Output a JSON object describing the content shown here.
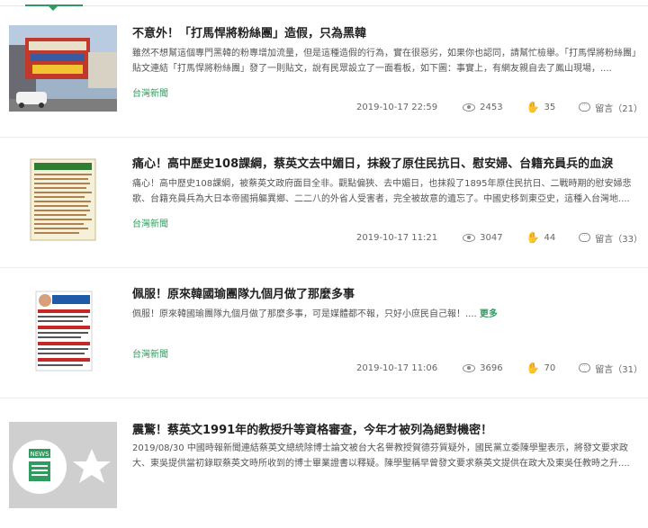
{
  "articles": [
    {
      "title": "不意外！「打馬悍將粉絲團」造假，只為黑韓",
      "summary": "雖然不想幫這個專門黑韓的粉專增加流量，但是這種造假的行為，實在很惡劣，如果你也認同，請幫忙檢舉。「打馬悍將粉絲團」貼文連結「打馬悍將粉絲團」發了一則貼文，說有民眾設立了一面看板，如下圖：事實上，有網友親自去了鳳山現場，....",
      "more": "",
      "source": "台灣新聞",
      "date": "2019-10-17 22:59",
      "views": "2453",
      "likes": "35",
      "comments": "留言（21）"
    },
    {
      "title": "痛心！高中歷史108課綱，蔡英文去中媚日，抹殺了原住民抗日、慰安婦、台籍充員兵的血淚",
      "summary": "痛心！高中歷史108課綱，被蔡英文政府面目全非。觀點偏狹、去中媚日，也抹殺了1895年原住民抗日、二戰時期的慰安婦悲歌、台籍充員兵為大日本帝國捐軀異鄉、二二八的外省人受害者，完全被故意的遺忘了。中國史移到東亞史，這種入台灣地....",
      "more": "",
      "source": "台灣新聞",
      "date": "2019-10-17 11:21",
      "views": "3047",
      "likes": "44",
      "comments": "留言（33）"
    },
    {
      "title": "佩服！原來韓國瑜團隊九個月做了那麼多事",
      "summary": "佩服！原來韓國瑜團隊九個月做了那麼多事，可是媒體都不報，只好小庶民自己報！....",
      "more": "更多",
      "source": "台灣新聞",
      "date": "2019-10-17 11:06",
      "views": "3696",
      "likes": "70",
      "comments": "留言（31）"
    },
    {
      "title": "震驚！蔡英文1991年的教授升等資格審查，今年才被列為絕對機密！",
      "summary": "2019/08/30 中國時報新聞連結蔡英文總統除博士論文被台大名譽教授賀德芬質疑外，國民黨立委陳學聖表示，將發文要求政大、東吳提供當初錄取蔡英文時所收到的博士畢業證書以釋疑。陳學聖稱早曾發文要求蔡英文提供在政大及東吳任教時之升....",
      "more": "",
      "source": "",
      "date": "",
      "views": "",
      "likes": "",
      "comments": ""
    }
  ],
  "thumb_badge": "NEWS",
  "thumb2_heading": "原住民抗日／慰安婦 課綱刪除",
  "thumb3_heading": "韓國瑜用心努力",
  "colors": {
    "accent": "#2e9c5e",
    "text": "#222222",
    "muted": "#666666"
  },
  "icons": {
    "views": "eye-icon",
    "likes": "thumbs-up-icon",
    "comments": "comment-icon"
  }
}
